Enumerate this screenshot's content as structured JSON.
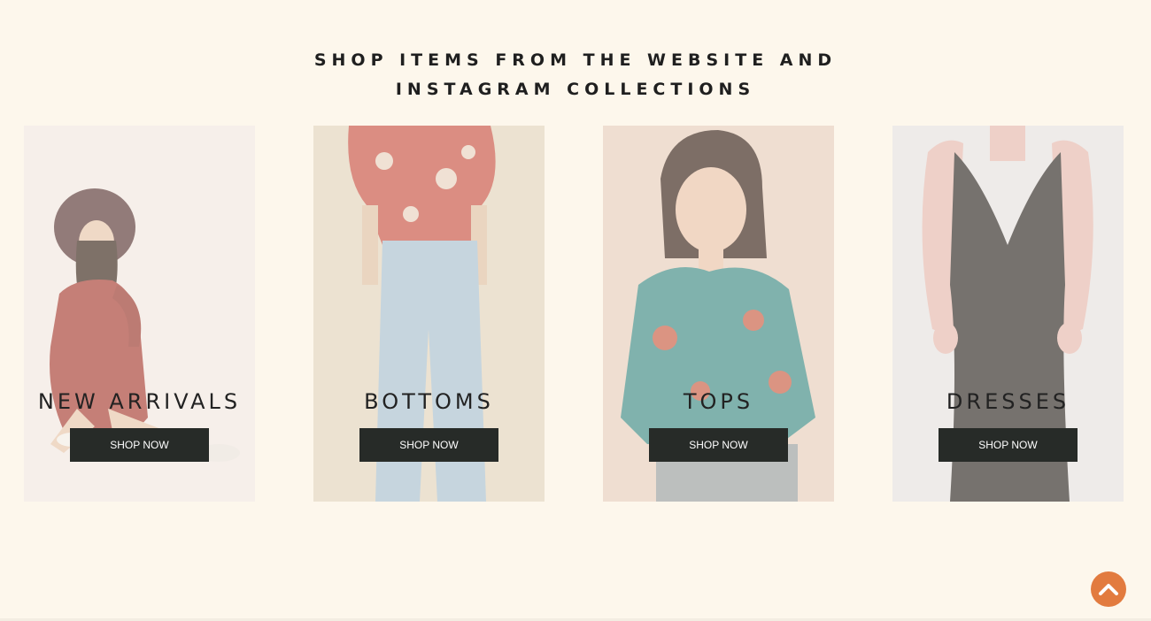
{
  "heading": {
    "line1": "SHOP ITEMS FROM THE WEBSITE AND",
    "line2": "INSTAGRAM COLLECTIONS"
  },
  "cards": [
    {
      "title": "NEW ARRIVALS",
      "button": "SHOP NOW"
    },
    {
      "title": "BOTTOMS",
      "button": "SHOP NOW"
    },
    {
      "title": "TOPS",
      "button": "SHOP NOW"
    },
    {
      "title": "DRESSES",
      "button": "SHOP NOW"
    }
  ],
  "colors": {
    "page_bg": "#fdf7ec",
    "button_bg": "#272b28",
    "scroll_top_bg": "#e27b3f"
  },
  "icons": {
    "scroll_top": "chevron-up-icon"
  }
}
